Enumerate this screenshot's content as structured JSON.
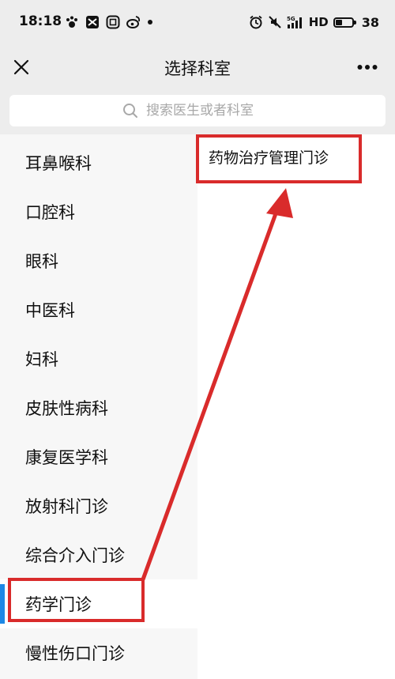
{
  "status_bar": {
    "time": "18:18",
    "network": "HD",
    "battery": "38",
    "battery_fill": 0.38
  },
  "nav": {
    "title": "选择科室"
  },
  "search": {
    "placeholder": "搜索医生或者科室"
  },
  "departments": [
    "耳鼻喉科",
    "口腔科",
    "眼科",
    "中医科",
    "妇科",
    "皮肤性病科",
    "康复医学科",
    "放射科门诊",
    "综合介入门诊",
    "药学门诊",
    "慢性伤口门诊"
  ],
  "selected_department": "药学门诊",
  "sub_departments": [
    "药物治疗管理门诊"
  ],
  "colors": {
    "accent": "#1e88e5",
    "annotation": "#d92b2b",
    "background": "#ededed"
  }
}
